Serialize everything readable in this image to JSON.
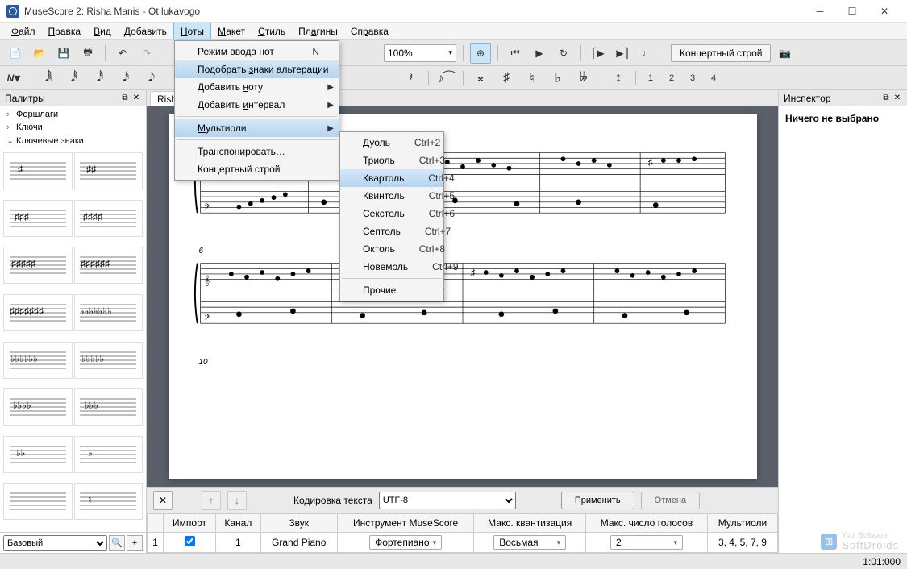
{
  "window": {
    "title": "MuseScore 2: Risha Manis - Ot lukavogo"
  },
  "menubar": {
    "items": [
      "Файл",
      "Правка",
      "Вид",
      "Добавить",
      "Ноты",
      "Макет",
      "Стиль",
      "Плагины",
      "Справка"
    ],
    "open_index": 4
  },
  "notes_menu": {
    "items": [
      {
        "label": "Режим ввода нот",
        "shortcut": "N"
      },
      {
        "label": "Подобрать знаки альтерации",
        "selected": true
      },
      {
        "label": "Добавить ноту",
        "submenu": true
      },
      {
        "label": "Добавить интервал",
        "submenu": true
      },
      {
        "sep": true
      },
      {
        "label": "Мультиоли",
        "submenu": true,
        "selected": true
      },
      {
        "sep": true
      },
      {
        "label": "Транспонировать…"
      },
      {
        "label": "Концертный строй"
      }
    ]
  },
  "tuplets_menu": {
    "items": [
      {
        "label": "Дуоль",
        "shortcut": "Ctrl+2"
      },
      {
        "label": "Триоль",
        "shortcut": "Ctrl+3"
      },
      {
        "label": "Квартоль",
        "shortcut": "Ctrl+4",
        "selected": true
      },
      {
        "label": "Квинтоль",
        "shortcut": "Ctrl+5"
      },
      {
        "label": "Секстоль",
        "shortcut": "Ctrl+6"
      },
      {
        "label": "Септоль",
        "shortcut": "Ctrl+7"
      },
      {
        "label": "Октоль",
        "shortcut": "Ctrl+8"
      },
      {
        "label": "Новемоль",
        "shortcut": "Ctrl+9"
      },
      {
        "sep": true
      },
      {
        "label": "Прочие"
      }
    ]
  },
  "toolbar1": {
    "tuning_label": "Концертный строй",
    "zoom": "100%"
  },
  "toolbar2": {
    "voices": [
      "1",
      "2",
      "3",
      "4"
    ]
  },
  "palette": {
    "title": "Палитры",
    "tree": [
      {
        "label": "Форшлаги",
        "expanded": false
      },
      {
        "label": "Ключи",
        "expanded": false
      },
      {
        "label": "Ключевые знаки",
        "expanded": true
      }
    ],
    "profile_label": "Базовый"
  },
  "document": {
    "tab": "Risha Manis - Ot lukavogo",
    "measure_markers": [
      "6",
      "10"
    ]
  },
  "inspector": {
    "title": "Инспектор",
    "empty_text": "Ничего не выбрано"
  },
  "encoding": {
    "label": "Кодировка текста",
    "value": "UTF-8",
    "apply": "Применить",
    "cancel": "Отмена"
  },
  "import_table": {
    "headers": [
      "",
      "Импорт",
      "Канал",
      "Звук",
      "Инструмент MuseScore",
      "Макс. квантизация",
      "Макс. число голосов",
      "Мультиоли"
    ],
    "row": {
      "index": "1",
      "import_checked": true,
      "channel": "1",
      "sound": "Grand Piano",
      "instrument": "Фортепиано",
      "quantization": "Восьмая",
      "max_voices": "2",
      "tuplets": "3, 4, 5, 7, 9"
    }
  },
  "statusbar": {
    "position": "1:01:000"
  },
  "watermark": {
    "text1": "Your Software",
    "text2": "SoftDroids"
  }
}
